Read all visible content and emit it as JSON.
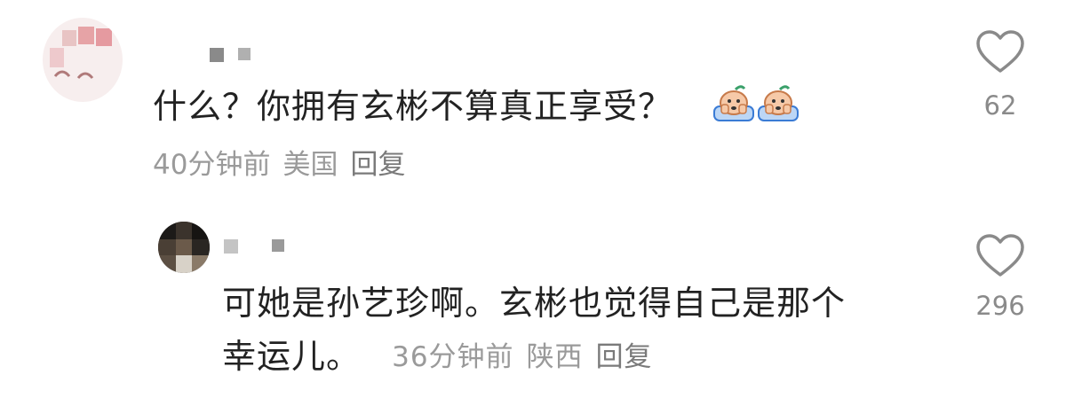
{
  "comments": [
    {
      "text": "什么？你拥有玄彬不算真正享受？",
      "emoji": [
        "crying-face-emoji",
        "crying-face-emoji"
      ],
      "time": "40分钟前",
      "location": "美国",
      "reply_label": "回复",
      "likes": "62"
    }
  ],
  "replies": [
    {
      "text_line1": "可她是孙艺珍啊。玄彬也觉得自己是那个",
      "text_line2": "幸运儿。",
      "time": "36分钟前",
      "location": "陕西",
      "reply_label": "回复",
      "likes": "296"
    }
  ],
  "icons": {
    "like": "heart-outline-icon"
  },
  "colors": {
    "text": "#222222",
    "meta": "#9a9a9a",
    "icon": "#8a8a8a"
  }
}
